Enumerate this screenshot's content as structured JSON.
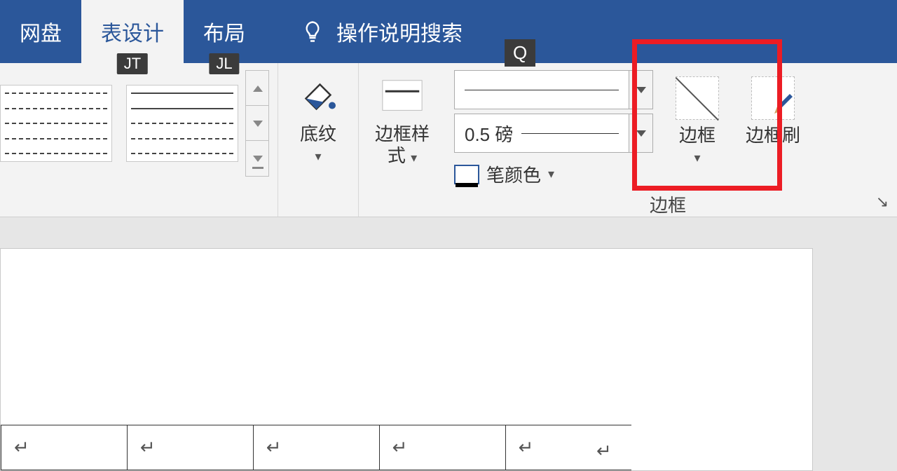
{
  "tabs": {
    "netdisk": "网盘",
    "table_design": "表设计",
    "layout": "布局"
  },
  "keytips": {
    "table_design": "JT",
    "layout": "JL",
    "search": "Q"
  },
  "search_placeholder": "操作说明搜索",
  "ribbon": {
    "shading_label": "底纹",
    "border_style_label": "边框样式",
    "pen_width_value": "0.5 磅",
    "pen_color_label": "笔颜色",
    "borders_label": "边框",
    "border_painter_label": "边框刷",
    "group_borders_label": "边框"
  },
  "glyphs": {
    "paragraph_mark": "↵",
    "chevron_down": "▾"
  }
}
